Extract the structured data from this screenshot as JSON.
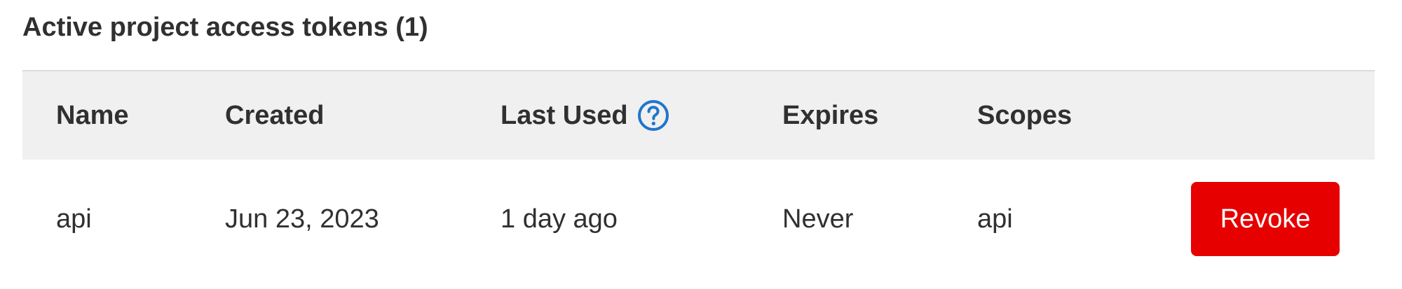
{
  "section": {
    "title": "Active project access tokens (1)"
  },
  "table": {
    "headers": {
      "name": "Name",
      "created": "Created",
      "last_used": "Last Used",
      "expires": "Expires",
      "scopes": "Scopes"
    },
    "rows": [
      {
        "name": "api",
        "created": "Jun 23, 2023",
        "last_used": "1 day ago",
        "expires": "Never",
        "scopes": "api",
        "action_label": "Revoke"
      }
    ]
  },
  "icons": {
    "help": "question-circle-icon"
  },
  "colors": {
    "header_background": "#f0f0f0",
    "text": "#303030",
    "link_blue": "#1f75cb",
    "danger": "#e60000"
  }
}
